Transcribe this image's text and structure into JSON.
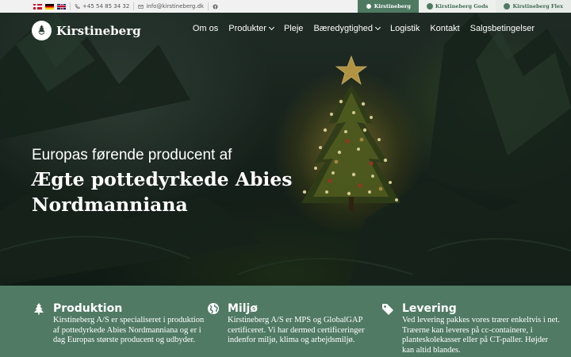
{
  "topbar": {
    "languages": [
      "Dansk",
      "Deutsch",
      "English"
    ],
    "phone": "+45 54 85 34 32",
    "email": "info@kirstineberg.dk",
    "brands": [
      {
        "label": "Kirstineberg"
      },
      {
        "label": "Kirstineberg Gods"
      },
      {
        "label": "Kirstineberg Flex"
      }
    ]
  },
  "header": {
    "logo_text": "Kirstineberg",
    "nav": [
      {
        "label": "Om os"
      },
      {
        "label": "Produkter"
      },
      {
        "label": "Pleje"
      },
      {
        "label": "Bæredygtighed"
      },
      {
        "label": "Logistik"
      },
      {
        "label": "Kontakt"
      },
      {
        "label": "Salgsbetingelser"
      }
    ]
  },
  "hero": {
    "subtitle": "Europas førende producent af",
    "title": "Ægte pottedyrkede Abies Nordmanniana"
  },
  "features": [
    {
      "title": "Produktion",
      "text": "Kirstineberg A/S er specialiseret i produktion af pottedyrkede Abies Nordmanniana og er i dag Europas største producent og udbyder.",
      "icon": "tree-icon"
    },
    {
      "title": "Miljø",
      "text": "Kirstineberg A/S er MPS og GlobalGAP certificeret. Vi har dermed certificeringer indenfor miljø, klima og arbejdsmiljø.",
      "icon": "globe-icon"
    },
    {
      "title": "Levering",
      "text": "Ved levering pakkes vores træer enkeltvis i net. Træerne kan leveres på cc-containere, i planteskolekasser eller på CT-paller. Højder kan altid blandes.",
      "icon": "tag-icon"
    }
  ],
  "colors": {
    "brand_green": "#507a64",
    "topbar_bg": "#f1f1f1"
  }
}
